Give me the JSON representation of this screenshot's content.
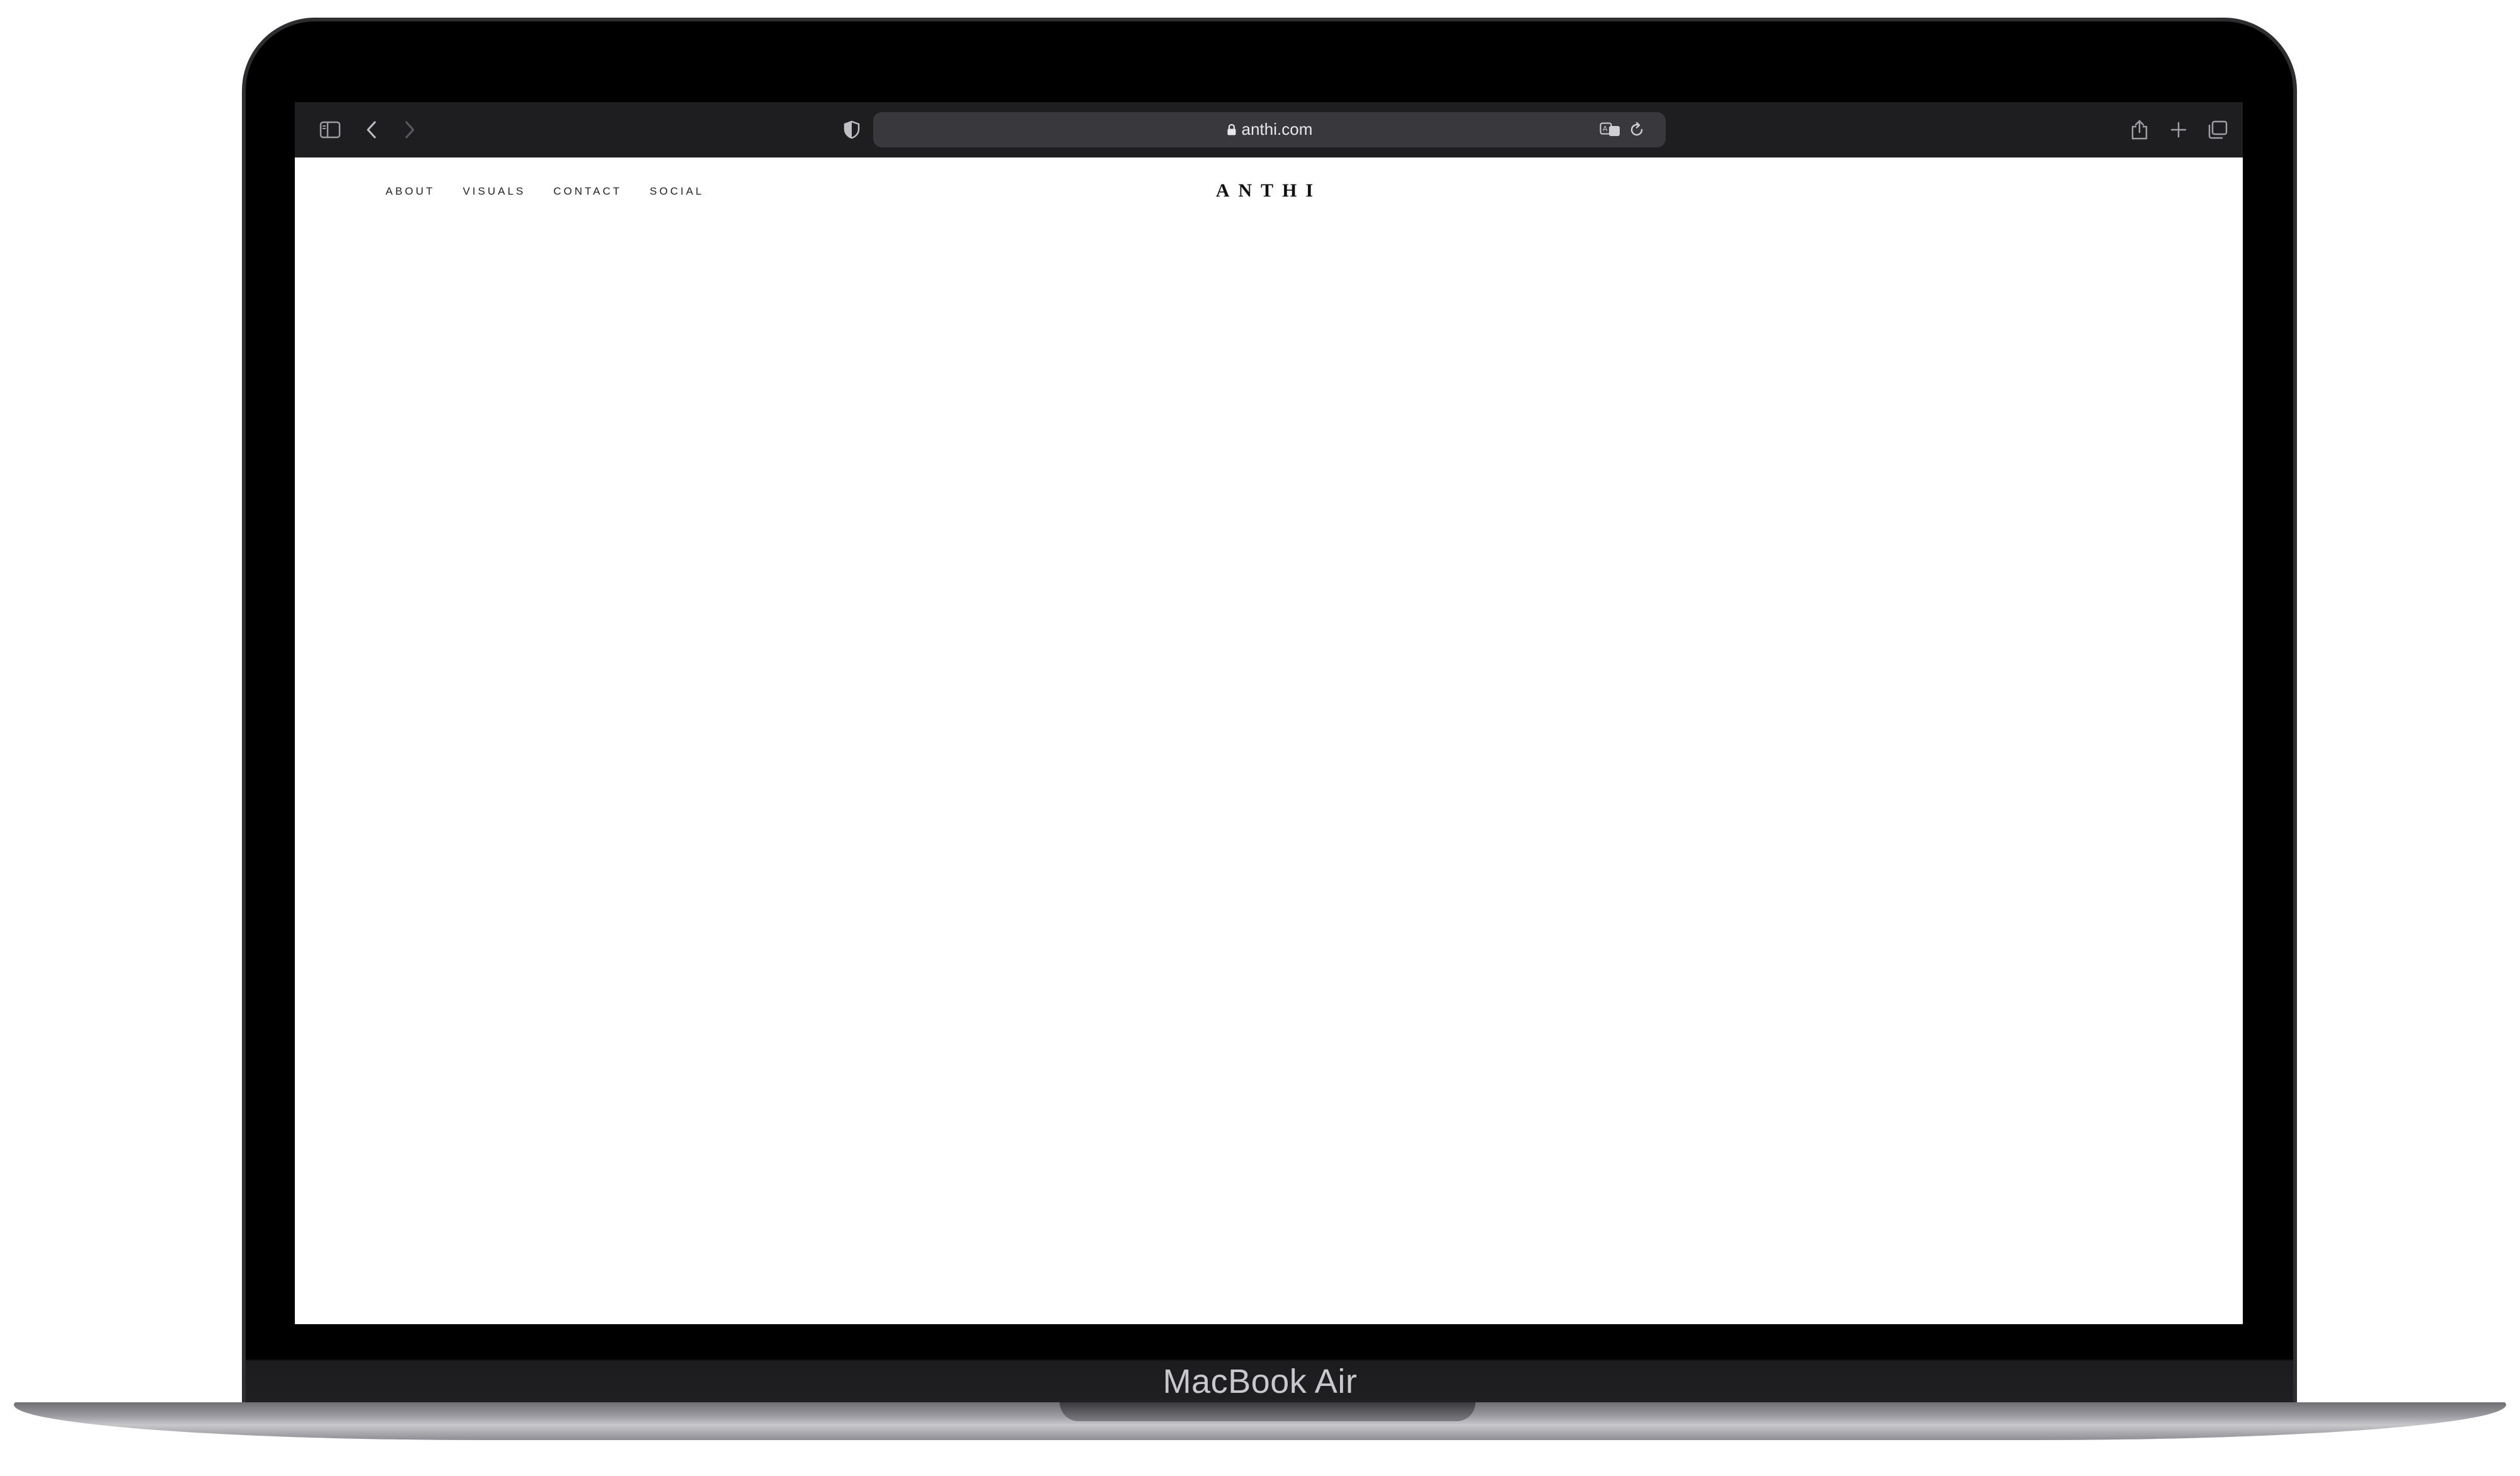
{
  "device": {
    "label": "MacBook Air"
  },
  "browser": {
    "address": "anthi.com",
    "icons": {
      "sidebar": "sidebar-icon",
      "back": "chevron-left-icon",
      "forward": "chevron-right-icon",
      "privacy": "shield-icon",
      "lock": "lock-icon",
      "translate": "translate-icon",
      "reload": "reload-icon",
      "share": "share-icon",
      "new_tab": "plus-icon",
      "tabs": "tabs-overview-icon"
    },
    "colors": {
      "toolbar": "#1e1e20",
      "address_bar": "#39393d",
      "icon": "#9c9ca2"
    }
  },
  "site": {
    "brand": "ANTHI",
    "nav": [
      {
        "label": "ABOUT"
      },
      {
        "label": "VISUALS"
      },
      {
        "label": "CONTACT"
      },
      {
        "label": "SOCIAL"
      }
    ],
    "colors": {
      "background": "#ffffff",
      "text": "#222222"
    }
  }
}
